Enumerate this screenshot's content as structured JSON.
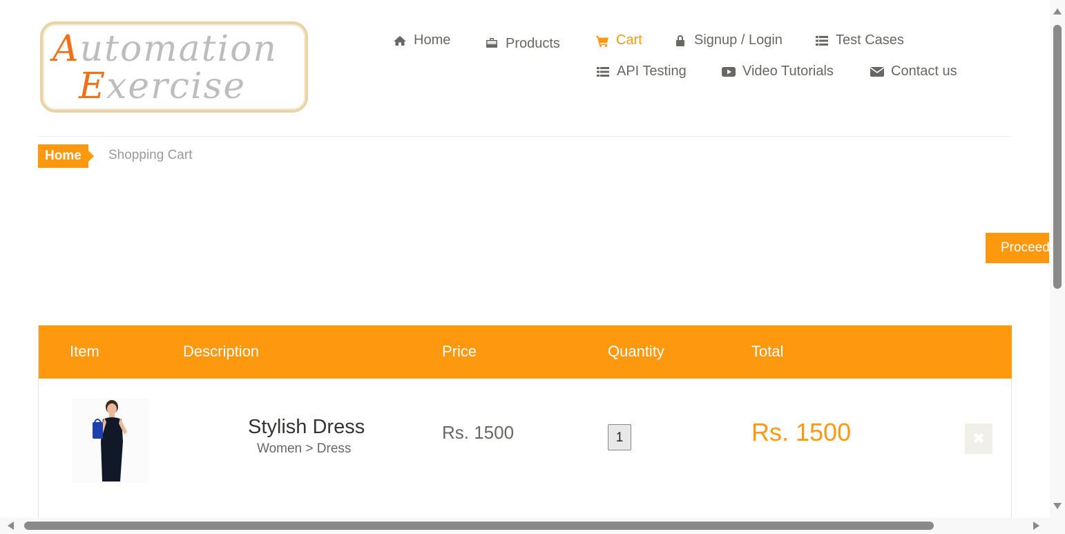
{
  "logo": {
    "line1_cap": "A",
    "line1_rest": "utomation",
    "line2_cap": "E",
    "line2_rest": "xercise"
  },
  "nav": {
    "home": "Home",
    "products": "Products",
    "cart": "Cart",
    "signup_login": "Signup / Login",
    "test_cases": "Test Cases",
    "api_testing": "API Testing",
    "video_tutorials": "Video Tutorials",
    "contact_us": "Contact us",
    "icons": {
      "home": "home-icon",
      "products": "briefcase-icon",
      "cart": "shopping-cart-icon",
      "signup_login": "lock-icon",
      "test_cases": "list-icon",
      "api_testing": "list-icon",
      "video_tutorials": "youtube-play-icon",
      "contact_us": "envelope-icon"
    },
    "active": "cart"
  },
  "breadcrumb": {
    "home": "Home",
    "current": "Shopping Cart"
  },
  "proceed_button": "Proceed",
  "cart": {
    "headers": {
      "item": "Item",
      "description": "Description",
      "price": "Price",
      "quantity": "Quantity",
      "total": "Total"
    },
    "rows": [
      {
        "image": "woman-black-dress-photo",
        "name": "Stylish Dress",
        "category": "Women > Dress",
        "price": "Rs. 1500",
        "quantity": "1",
        "total": "Rs. 1500",
        "delete_icon": "close-icon"
      }
    ]
  },
  "colors": {
    "accent": "#fe980f",
    "text": "#696763",
    "logo_accent": "#f56f17"
  }
}
